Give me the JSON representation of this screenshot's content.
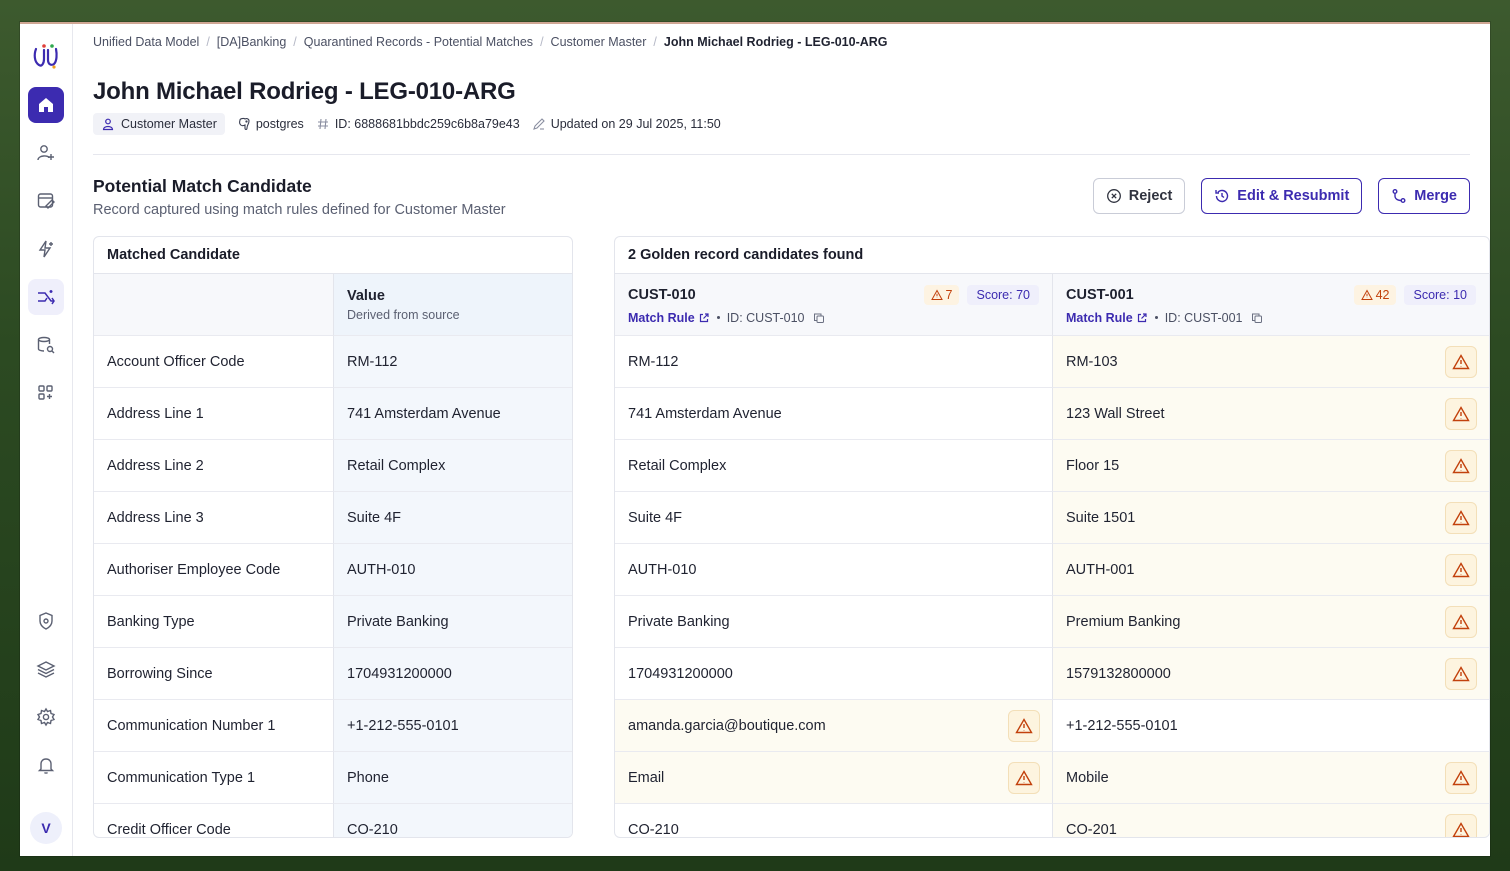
{
  "colors": {
    "accent": "#3c2bb0",
    "warning": "#c2410c"
  },
  "sidebar": {
    "items": [
      {
        "icon": "home-icon"
      },
      {
        "icon": "user-sparkle-icon"
      },
      {
        "icon": "data-edit-icon"
      },
      {
        "icon": "flash-sparkle-icon"
      },
      {
        "icon": "merge-arrows-icon"
      },
      {
        "icon": "database-search-icon"
      },
      {
        "icon": "apps-add-icon"
      },
      {
        "icon": "shield-settings-icon"
      },
      {
        "icon": "layers-icon"
      },
      {
        "icon": "gear-icon"
      },
      {
        "icon": "bell-icon"
      }
    ],
    "avatar": "V"
  },
  "breadcrumb": [
    "Unified Data Model",
    "[DA]Banking",
    "Quarantined Records - Potential Matches",
    "Customer Master",
    "John Michael Rodrieg - LEG-010-ARG"
  ],
  "header": {
    "title": "John Michael Rodrieg - LEG-010-ARG",
    "entity": "Customer Master",
    "source": "postgres",
    "id": "ID: 6888681bbdc259c6b8a79e43",
    "updated": "Updated on 29 Jul 2025, 11:50"
  },
  "section": {
    "title": "Potential Match Candidate",
    "subtitle": "Record captured using match rules defined for Customer Master"
  },
  "actions": {
    "reject": "Reject",
    "edit": "Edit & Resubmit",
    "merge": "Merge"
  },
  "matched": {
    "title": "Matched Candidate",
    "value_header": "Value",
    "value_sub": "Derived from source",
    "rows": [
      {
        "field": "Account Officer Code",
        "value": "RM-112"
      },
      {
        "field": "Address Line 1",
        "value": "741 Amsterdam Avenue"
      },
      {
        "field": "Address Line 2",
        "value": "Retail Complex"
      },
      {
        "field": "Address Line 3",
        "value": "Suite 4F"
      },
      {
        "field": "Authoriser Employee Code",
        "value": "AUTH-010"
      },
      {
        "field": "Banking Type",
        "value": "Private Banking"
      },
      {
        "field": "Borrowing Since",
        "value": "1704931200000"
      },
      {
        "field": "Communication Number 1",
        "value": "+1-212-555-0101"
      },
      {
        "field": "Communication Type 1",
        "value": "Phone"
      },
      {
        "field": "Credit Officer Code",
        "value": "CO-210"
      }
    ]
  },
  "golden": {
    "title": "2 Golden record candidates found",
    "candidates": [
      {
        "name": "CUST-010",
        "warnings": "7",
        "score": "Score: 70",
        "match_rule": "Match Rule",
        "id": "ID: CUST-010",
        "values": [
          "RM-112",
          "741 Amsterdam Avenue",
          "Retail Complex",
          "Suite 4F",
          "AUTH-010",
          "Private Banking",
          "1704931200000",
          "amanda.garcia@boutique.com",
          "Email",
          "CO-210"
        ],
        "mismatch": [
          false,
          false,
          false,
          false,
          false,
          false,
          false,
          true,
          true,
          false
        ]
      },
      {
        "name": "CUST-001",
        "warnings": "42",
        "score": "Score: 10",
        "match_rule": "Match Rule",
        "id": "ID: CUST-001",
        "values": [
          "RM-103",
          "123 Wall Street",
          "Floor 15",
          "Suite 1501",
          "AUTH-001",
          "Premium Banking",
          "1579132800000",
          "+1-212-555-0101",
          "Mobile",
          "CO-201"
        ],
        "mismatch": [
          true,
          true,
          true,
          true,
          true,
          true,
          true,
          false,
          true,
          true
        ]
      }
    ]
  }
}
